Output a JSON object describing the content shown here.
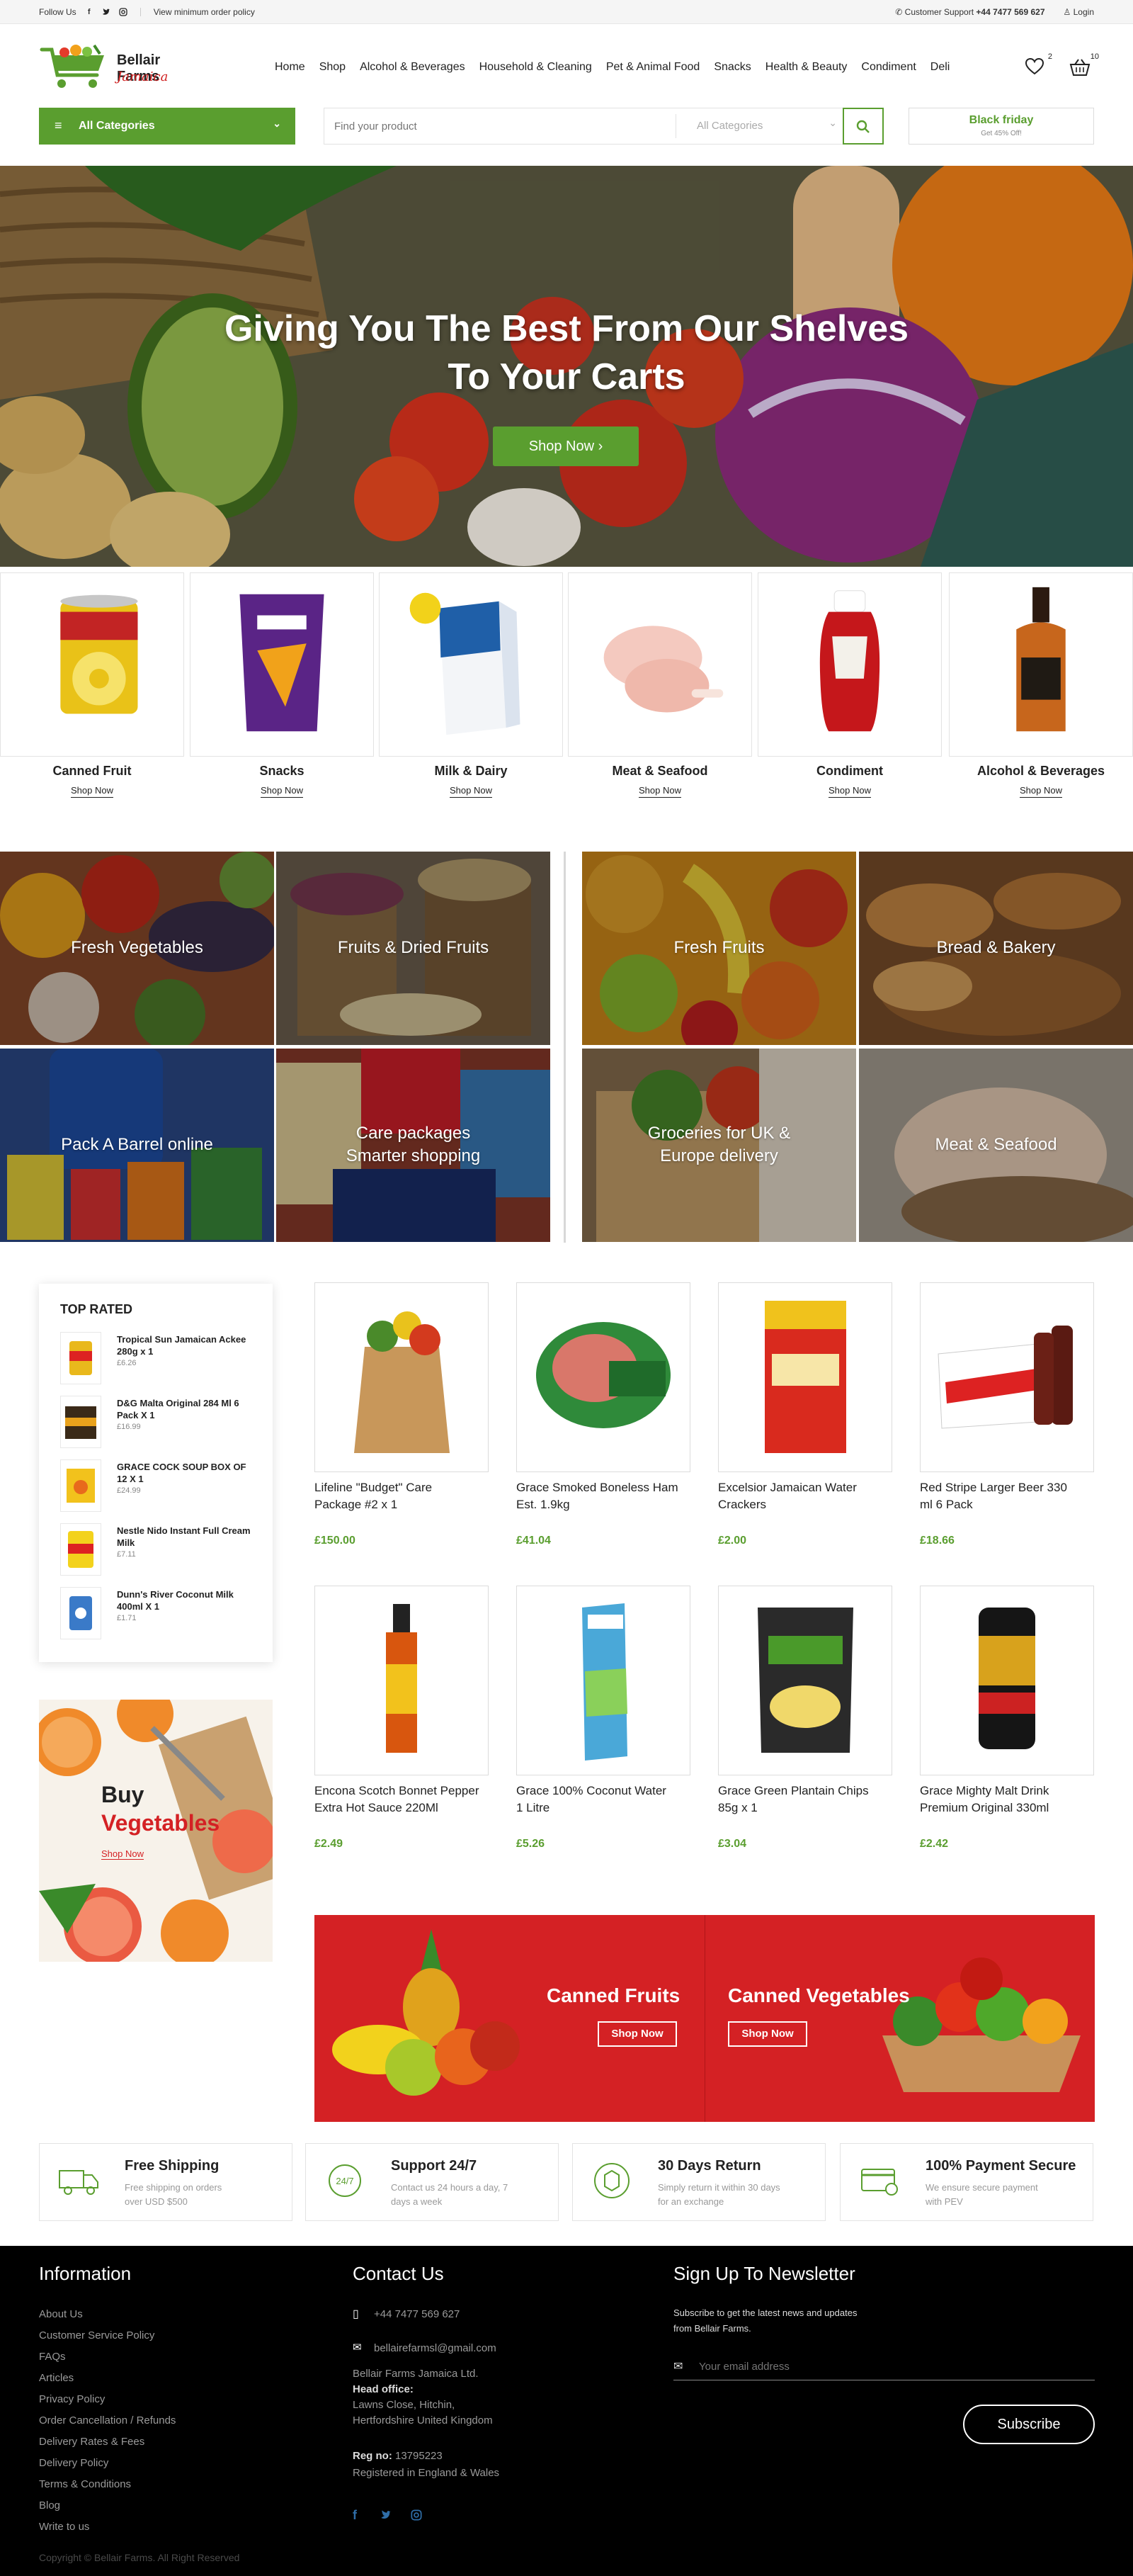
{
  "topbar": {
    "follow_label": "Follow Us",
    "min_order_label": "View minimum order policy",
    "support_label": "Customer Support",
    "support_phone": "+44 7477 569 627",
    "login_label": "Login"
  },
  "brand": {
    "name_line1": "Bellair Farms",
    "name_line2": "Jamaica"
  },
  "nav": [
    "Home",
    "Shop",
    "Alcohol & Beverages",
    "Household & Cleaning",
    "Pet & Animal Food",
    "Snacks",
    "Health & Beauty",
    "Condiment",
    "Deli"
  ],
  "header_icons": {
    "wishlist_count": "2",
    "cart_count": "10"
  },
  "categories_button": "All Categories",
  "search": {
    "placeholder": "Find your product",
    "category_select": "All Categories"
  },
  "promo": {
    "title": "Black friday",
    "subtitle": "Get 45% Off!"
  },
  "hero": {
    "headline_line1": "Giving You The Best From Our Shelves",
    "headline_line2": "To Your Carts",
    "button": "Shop Now"
  },
  "carousel": [
    {
      "name": "Canned Fruit",
      "link": "Shop Now"
    },
    {
      "name": "Snacks",
      "link": "Shop Now"
    },
    {
      "name": "Milk & Dairy",
      "link": "Shop Now"
    },
    {
      "name": "Meat & Seafood",
      "link": "Shop Now"
    },
    {
      "name": "Condiment",
      "link": "Shop Now"
    },
    {
      "name": "Alcohol & Beverages",
      "link": "Shop Now"
    }
  ],
  "tiles": [
    {
      "label_line1": "Fresh Vegetables",
      "label_line2": ""
    },
    {
      "label_line1": "Fruits & Dried Fruits",
      "label_line2": ""
    },
    {
      "label_line1": "Fresh Fruits",
      "label_line2": ""
    },
    {
      "label_line1": "Bread & Bakery",
      "label_line2": ""
    },
    {
      "label_line1": "Pack A Barrel online",
      "label_line2": ""
    },
    {
      "label_line1": "Care packages",
      "label_line2": "Smarter shopping"
    },
    {
      "label_line1": "Groceries for UK &",
      "label_line2": "Europe delivery"
    },
    {
      "label_line1": "Meat & Seafood",
      "label_line2": ""
    }
  ],
  "top_rated": {
    "title": "TOP RATED",
    "items": [
      {
        "name": "Tropical Sun Jamaican Ackee 280g x 1",
        "price": "£6.26"
      },
      {
        "name": "D&G Malta Original 284 Ml 6 Pack X 1",
        "price": "£16.99"
      },
      {
        "name": "GRACE COCK SOUP BOX OF 12 X 1",
        "price": "£24.99"
      },
      {
        "name": "Nestle Nido Instant Full Cream Milk",
        "price": "£7.11"
      },
      {
        "name": "Dunn's River Coconut Milk 400ml X 1",
        "price": "£1.71"
      }
    ]
  },
  "buy_vegetables": {
    "line1": "Buy",
    "line2": "Vegetables",
    "link": "Shop Now"
  },
  "products": [
    {
      "name_line1": "Lifeline \"Budget\" Care",
      "name_line2": "Package #2 x 1",
      "price": "£150.00"
    },
    {
      "name_line1": "Grace Smoked Boneless Ham",
      "name_line2": "Est. 1.9kg",
      "price": "£41.04"
    },
    {
      "name_line1": "Excelsior Jamaican Water",
      "name_line2": "Crackers",
      "price": "£2.00"
    },
    {
      "name_line1": "Red Stripe Larger Beer 330",
      "name_line2": "ml 6 Pack",
      "price": "£18.66"
    },
    {
      "name_line1": "Encona Scotch Bonnet Pepper",
      "name_line2": "Extra Hot Sauce 220Ml",
      "price": "£2.49"
    },
    {
      "name_line1": "Grace 100% Coconut Water",
      "name_line2": "1 Litre",
      "price": "£5.26"
    },
    {
      "name_line1": "Grace Green Plantain Chips",
      "name_line2": "85g x 1",
      "price": "£3.04"
    },
    {
      "name_line1": "Grace Mighty Malt Drink",
      "name_line2": "Premium Original 330ml",
      "price": "£2.42"
    }
  ],
  "banners": [
    {
      "title": "Canned Fruits",
      "button": "Shop Now"
    },
    {
      "title": "Canned Vegetables",
      "button": "Shop Now"
    }
  ],
  "features": [
    {
      "title": "Free Shipping",
      "desc_line1": "Free shipping on orders",
      "desc_line2": "over USD $500"
    },
    {
      "title": "Support 24/7",
      "desc_line1": "Contact us 24 hours a day, 7",
      "desc_line2": "days a week"
    },
    {
      "title": "30 Days Return",
      "desc_line1": "Simply return it within 30 days",
      "desc_line2": "for an exchange"
    },
    {
      "title": "100% Payment Secure",
      "desc_line1": "We ensure secure payment",
      "desc_line2": "with PEV"
    }
  ],
  "footer": {
    "info_title": "Information",
    "info_links": [
      "About Us",
      "Customer Service Policy",
      "FAQs",
      "Articles",
      "Privacy Policy",
      "Order Cancellation / Refunds",
      "Delivery Rates & Fees",
      "Delivery Policy",
      "Terms & Conditions",
      "Blog",
      "Write to us"
    ],
    "contact_title": "Contact Us",
    "phone": "+44 7477 569 627",
    "email": "bellairefarmsl@gmail.com",
    "company": "Bellair Farms Jamaica Ltd.",
    "head_office_label": "Head office:",
    "address_line1": "Lawns Close, Hitchin,",
    "address_line2": "Hertfordshire United Kingdom",
    "reg_label": "Reg no:",
    "reg_no": "13795223",
    "registered": "Registered in England & Wales",
    "newsletter_title": "Sign Up To Newsletter",
    "newsletter_desc_line1": "Subscribe to get the latest news and updates",
    "newsletter_desc_line2": "from Bellair Farms.",
    "email_placeholder": "Your email address",
    "subscribe": "Subscribe",
    "copyright": "Copyright © Bellair Farms. All Right Reserved"
  },
  "colors": {
    "brand_green": "#5a9e2f",
    "accent_red": "#d42124",
    "footer_bg": "#000000"
  }
}
